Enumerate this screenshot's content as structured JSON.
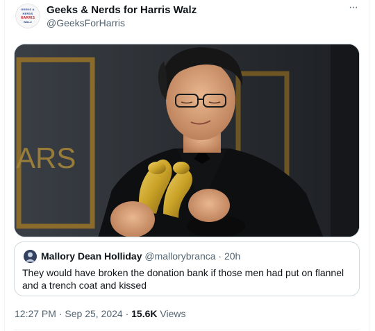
{
  "tweet": {
    "author_name": "Geeks & Nerds for Harris Walz",
    "author_handle": "@GeeksForHarris",
    "avatar_text": [
      "GEEKS & NERDS",
      "HARRIS",
      "WALZ"
    ],
    "more_label": "···",
    "media": {
      "backdrop_text": "ARS"
    },
    "quote": {
      "author_name": "Mallory Dean Holliday",
      "author_handle": "@mallorybranca",
      "separator": "·",
      "age": "20h",
      "text": "They would have broken the donation bank if those men had put on flannel and a trench coat and kissed"
    },
    "footer": {
      "time": "12:27 PM",
      "sep1": "·",
      "date": "Sep 25, 2024",
      "sep2": "·",
      "views_count": "15.6K",
      "views_label": "Views"
    }
  },
  "colors": {
    "text_primary": "#0f1419",
    "text_secondary": "#536471",
    "border": "#cfd9de",
    "brand_red": "#c1272d",
    "brand_blue": "#233e8b",
    "award_gold": "#c9a227"
  }
}
